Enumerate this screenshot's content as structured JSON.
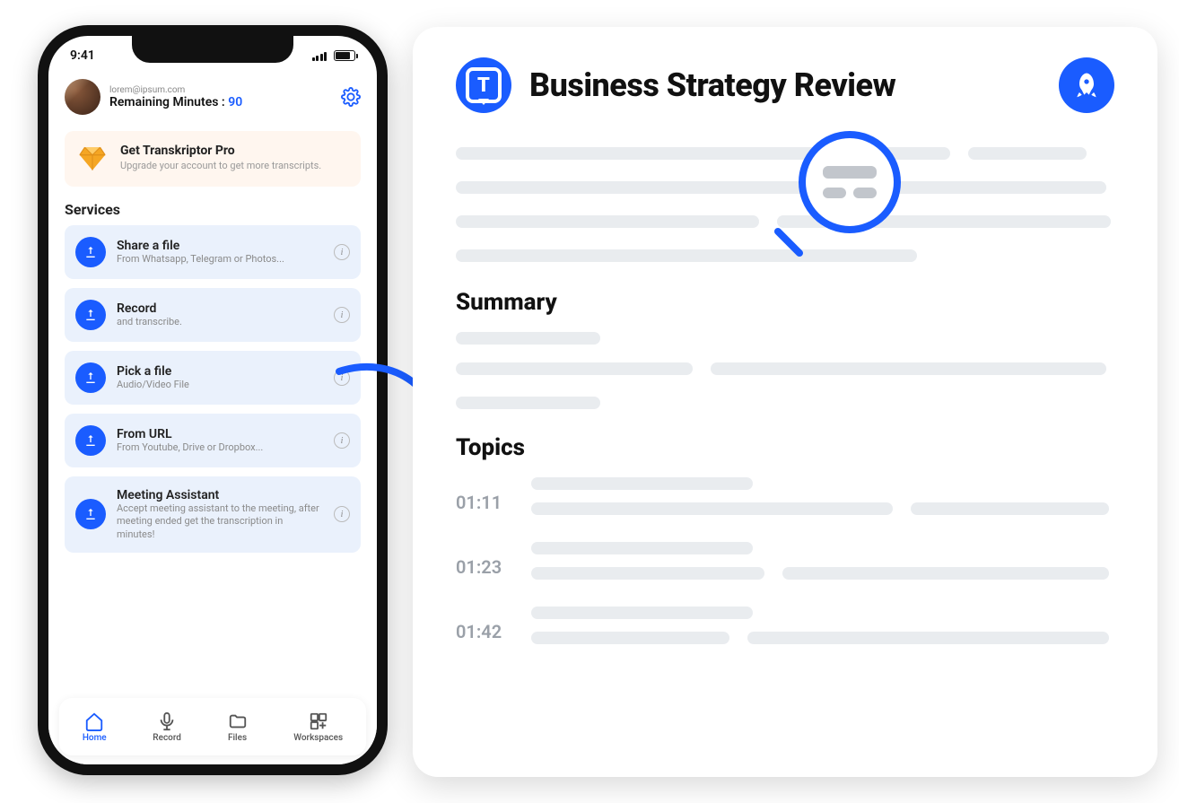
{
  "phone": {
    "status": {
      "time": "9:41"
    },
    "user": {
      "email": "lorem@ipsum.com",
      "remaining_label": "Remaining Minutes :",
      "remaining_value": "90"
    },
    "promo": {
      "title": "Get Transkriptor Pro",
      "subtitle": "Upgrade your account to get more transcripts."
    },
    "services_heading": "Services",
    "services": [
      {
        "title": "Share a file",
        "subtitle": "From Whatsapp, Telegram or Photos..."
      },
      {
        "title": "Record",
        "subtitle": "and transcribe."
      },
      {
        "title": "Pick a file",
        "subtitle": "Audio/Video File"
      },
      {
        "title": "From URL",
        "subtitle": "From Youtube, Drive or Dropbox..."
      },
      {
        "title": "Meeting Assistant",
        "subtitle": "Accept meeting assistant to the meeting, after meeting ended get the transcription in minutes!"
      }
    ],
    "tabs": [
      {
        "label": "Home"
      },
      {
        "label": "Record"
      },
      {
        "label": "Files"
      },
      {
        "label": "Workspaces"
      }
    ]
  },
  "doc": {
    "title": "Business Strategy Review",
    "summary_heading": "Summary",
    "topics_heading": "Topics",
    "topics": [
      {
        "time": "01:11"
      },
      {
        "time": "01:23"
      },
      {
        "time": "01:42"
      }
    ]
  },
  "icons": {
    "logo_letter": "T"
  }
}
